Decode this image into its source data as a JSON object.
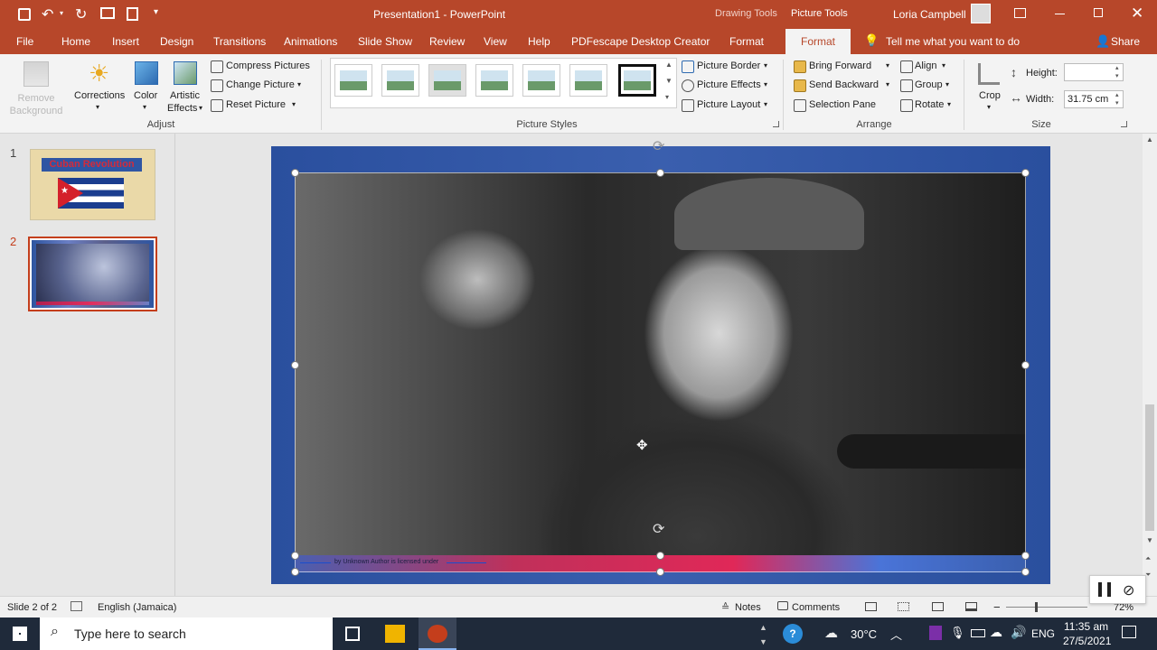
{
  "title_bar": {
    "doc_title": "Presentation1  -  PowerPoint",
    "context_tools": [
      "Drawing Tools",
      "Picture Tools"
    ],
    "user_name": "Loria Campbell"
  },
  "tabs": [
    "File",
    "Home",
    "Insert",
    "Design",
    "Transitions",
    "Animations",
    "Slide Show",
    "Review",
    "View",
    "Help",
    "PDFescape Desktop Creator",
    "Format",
    "Format"
  ],
  "tell_me": "Tell me what you want to do",
  "share": "Share",
  "ribbon": {
    "remove_bg": "Remove Background",
    "corrections": "Corrections",
    "color": "Color",
    "artistic_1": "Artistic",
    "artistic_2": "Effects",
    "compress": "Compress Pictures",
    "change": "Change Picture",
    "reset": "Reset Picture",
    "adjust_label": "Adjust",
    "styles_label": "Picture Styles",
    "border": "Picture Border",
    "effects": "Picture Effects",
    "layout": "Picture Layout",
    "bring_forward": "Bring Forward",
    "send_backward": "Send Backward",
    "selection_pane": "Selection Pane",
    "align": "Align",
    "group": "Group",
    "rotate": "Rotate",
    "arrange_label": "Arrange",
    "crop": "Crop",
    "height_label": "Height:",
    "height_value": "",
    "width_label": "Width:",
    "width_value": "31.75 cm",
    "size_label": "Size"
  },
  "slides": [
    {
      "num": "1",
      "title": "Cuban Revolution"
    },
    {
      "num": "2"
    }
  ],
  "caption": {
    "text": "by Unknown Author is licensed under"
  },
  "status": {
    "slide": "Slide 2 of 2",
    "language": "English (Jamaica)",
    "notes": "Notes",
    "comments": "Comments",
    "zoom": "72%"
  },
  "taskbar": {
    "search": "Type here to search",
    "temp": "30°C",
    "lang": "ENG",
    "time": "11:35 am",
    "date": "27/5/2021"
  },
  "colors": {
    "accent": "#b7472a",
    "slide_blue": "#2f56a3",
    "taskbar": "#1f2a3a"
  }
}
